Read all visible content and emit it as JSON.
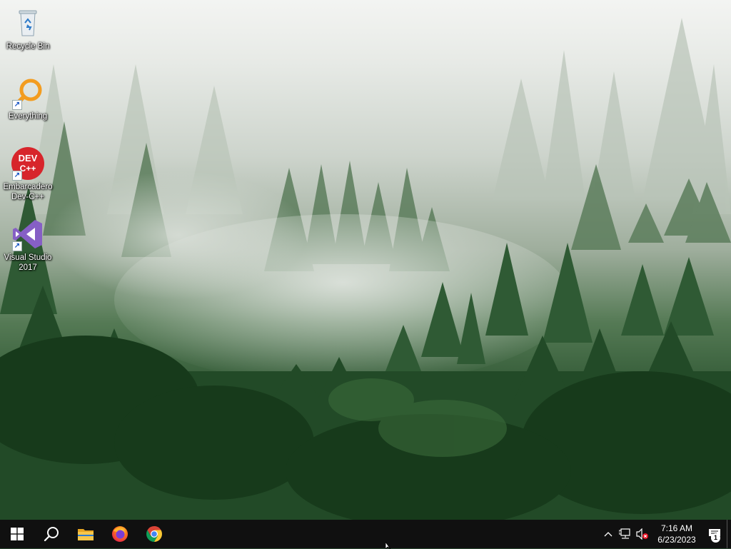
{
  "desktop": {
    "icons": [
      {
        "label": "Recycle Bin",
        "icon": "recycle-bin-icon"
      },
      {
        "label": "Everything",
        "icon": "everything-search-icon"
      },
      {
        "label": "Embarcadero\nDev-C++",
        "icon": "devcpp-icon",
        "badge_text": "DEV\nC++"
      },
      {
        "label": "Visual Studio\n2017",
        "icon": "visual-studio-icon"
      }
    ]
  },
  "taskbar": {
    "pinned": [
      {
        "name": "start",
        "icon": "windows-logo-icon"
      },
      {
        "name": "search",
        "icon": "search-icon"
      },
      {
        "name": "file-explorer",
        "icon": "folder-icon"
      },
      {
        "name": "firefox",
        "icon": "firefox-icon"
      },
      {
        "name": "chrome",
        "icon": "chrome-icon"
      }
    ],
    "tray": {
      "icons": [
        "chevron-up-icon",
        "network-icon",
        "volume-muted-icon"
      ],
      "time": "7:16 AM",
      "date": "6/23/2023",
      "notification_count": "1"
    }
  },
  "colors": {
    "taskbar": "#101010",
    "accent_orange": "#f39c1f",
    "devcpp_red": "#d7252b",
    "vs_purple": "#865fc5"
  }
}
